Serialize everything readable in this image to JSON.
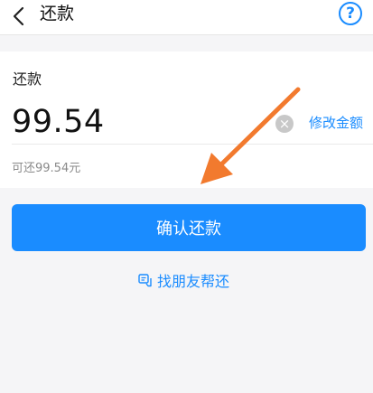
{
  "header": {
    "back_icon": "chevron-left-icon",
    "title": "还款",
    "help_icon": "help-circle-icon",
    "help_glyph": "?"
  },
  "repay": {
    "section_label": "还款",
    "amount": "99.54",
    "clear_icon": "clear-circle-icon",
    "clear_glyph": "×",
    "modify_label": "修改金额",
    "available_text": "可还99.54元"
  },
  "actions": {
    "confirm_label": "确认还款",
    "friend_icon": "chat-icon",
    "friend_label": "找朋友帮还"
  },
  "colors": {
    "accent": "#1a8cff",
    "annotation_arrow": "#f27a2e"
  }
}
